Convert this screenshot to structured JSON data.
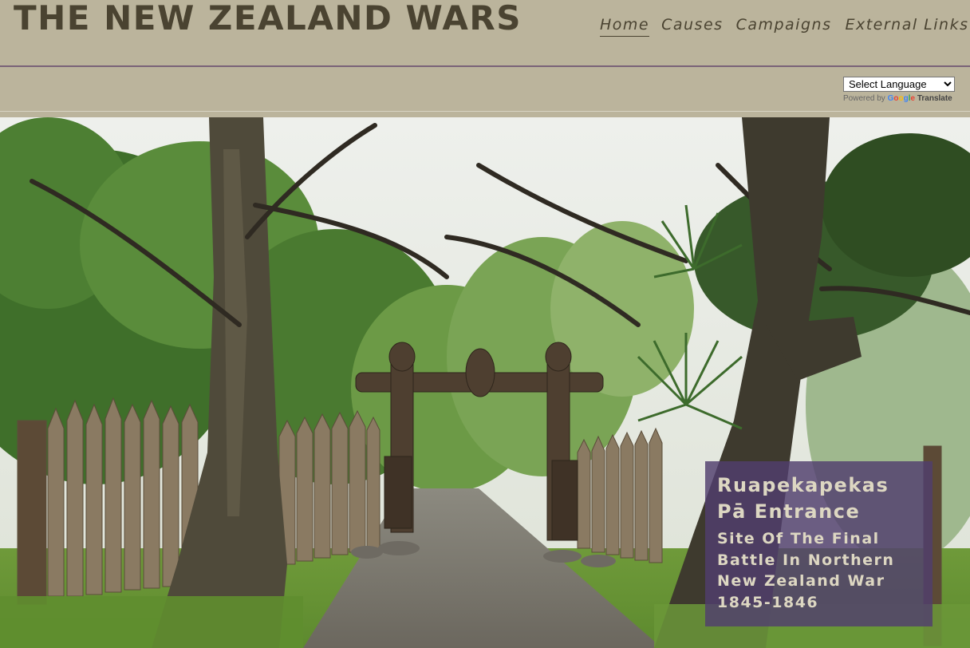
{
  "site": {
    "title": "THE NEW ZEALAND WARS"
  },
  "nav": {
    "items": [
      {
        "label": "Home",
        "active": true
      },
      {
        "label": "Causes"
      },
      {
        "label": "Campaigns"
      },
      {
        "label": "External Links"
      }
    ]
  },
  "translate": {
    "select_label": "Select Language",
    "powered_by": "Powered by",
    "google": "Google",
    "translate_word": "Translate"
  },
  "hero": {
    "caption_title_line1": "Ruapekapekas",
    "caption_title_line2": "Pā Entrance",
    "caption_sub_line1": "Site Of The Final",
    "caption_sub_line2": "Battle In Northern",
    "caption_sub_line3": "New Zealand War",
    "caption_sub_line4": "1845-1846"
  },
  "colors": {
    "header_bg": "#bbb49c",
    "title_text": "#4a4331",
    "divider": "#7a6378",
    "caption_bg": "#503e6e",
    "caption_text": "#ddd7c2"
  }
}
